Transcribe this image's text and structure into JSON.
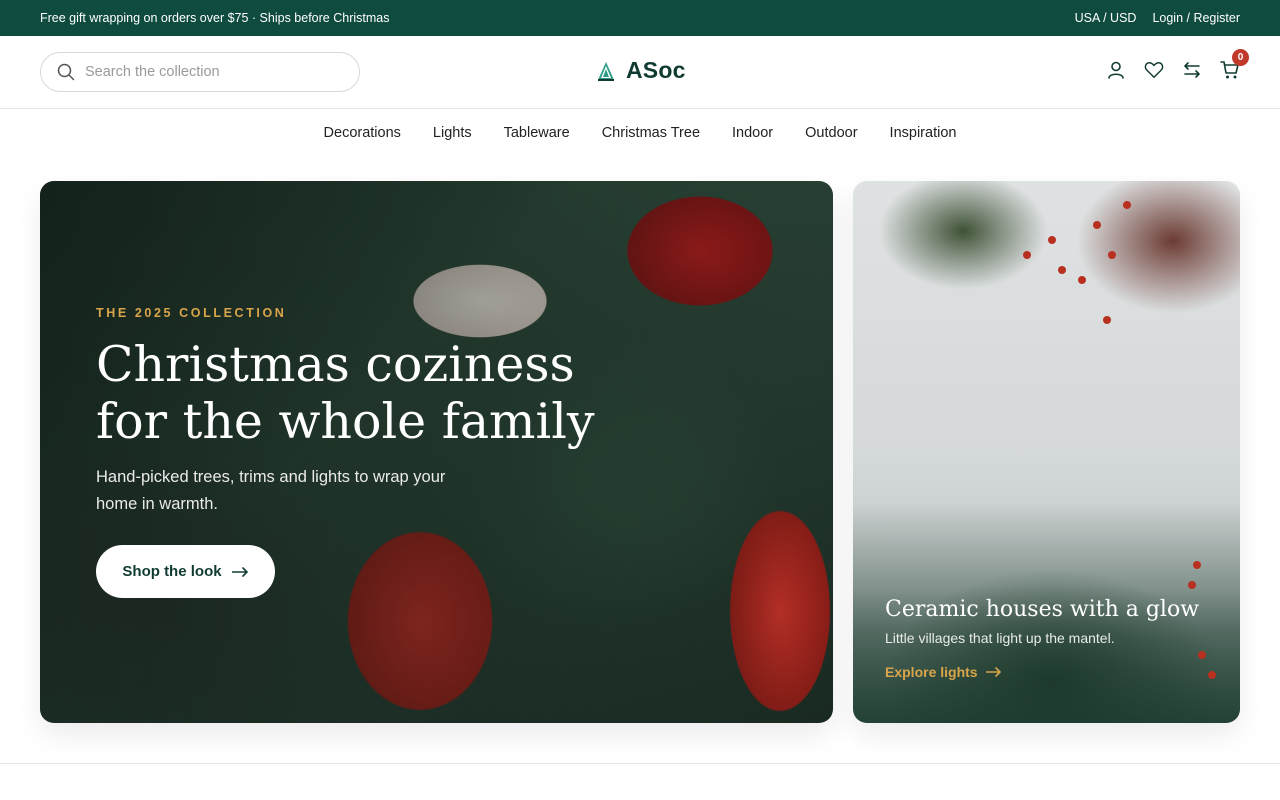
{
  "topbar": {
    "promo": "Free gift wrapping on orders over $75 · Ships before Christmas",
    "currency": "USA / USD",
    "account": "Login / Register"
  },
  "header": {
    "search_placeholder": "Search the collection",
    "brand": "ASoc",
    "cart_count": "0",
    "icons": [
      "account-icon",
      "wishlist-icon",
      "compare-icon",
      "cart-icon"
    ]
  },
  "nav": [
    "Decorations",
    "Lights",
    "Tableware",
    "Christmas Tree",
    "Indoor",
    "Outdoor",
    "Inspiration"
  ],
  "hero": {
    "eyebrow": "THE 2025 COLLECTION",
    "headline_line1": "Christmas coziness",
    "headline_line2": "for the whole family",
    "subtitle": "Hand-picked trees, trims and lights to wrap your home in warmth.",
    "cta": "Shop the look"
  },
  "card": {
    "title": "Ceramic houses with a glow",
    "subtitle": "Little villages that light up the mantel.",
    "link": "Explore lights"
  },
  "colors": {
    "brand_green": "#0f4c3f",
    "accent_gold": "#d9a54a",
    "badge_red": "#c0392b"
  }
}
